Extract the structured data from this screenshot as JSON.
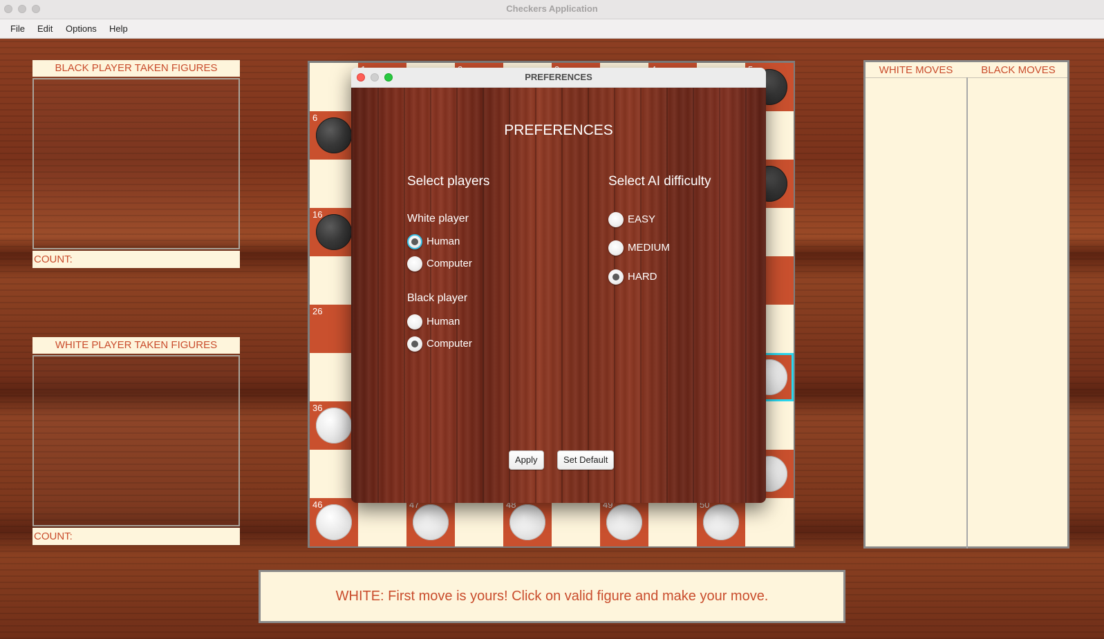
{
  "window": {
    "title": "Checkers Application"
  },
  "menu": {
    "file": "File",
    "edit": "Edit",
    "options": "Options",
    "help": "Help"
  },
  "left_panel": {
    "black_taken_title": "BLACK PLAYER TAKEN FIGURES",
    "black_count_label": "COUNT:",
    "white_taken_title": "WHITE PLAYER TAKEN FIGURES",
    "white_count_label": "COUNT:"
  },
  "board": {
    "visible_numbers": {
      "n1": "1",
      "n2": "2",
      "n3": "3",
      "n4": "4",
      "n5": "5",
      "n6": "6",
      "n16": "16",
      "n26": "26",
      "n36": "36",
      "n46": "46",
      "n47": "47",
      "n48": "48",
      "n49": "49",
      "n50": "50"
    }
  },
  "moves": {
    "white_header": "WHITE MOVES",
    "black_header": "BLACK MOVES"
  },
  "status": {
    "message": "WHITE: First move is yours!  Click on valid figure and make your move."
  },
  "preferences_dialog": {
    "window_title": "PREFERENCES",
    "heading": "PREFERENCES",
    "select_players": "Select players",
    "white_player": "White player",
    "black_player": "Black player",
    "white_options": [
      "Human",
      "Computer"
    ],
    "white_selected": "Human",
    "black_options": [
      "Human",
      "Computer"
    ],
    "black_selected": "Computer",
    "ai_title": "Select AI difficulty",
    "ai_options": [
      "EASY",
      "MEDIUM",
      "HARD"
    ],
    "ai_selected": "HARD",
    "apply_button": "Apply",
    "set_default_button": "Set Default"
  }
}
